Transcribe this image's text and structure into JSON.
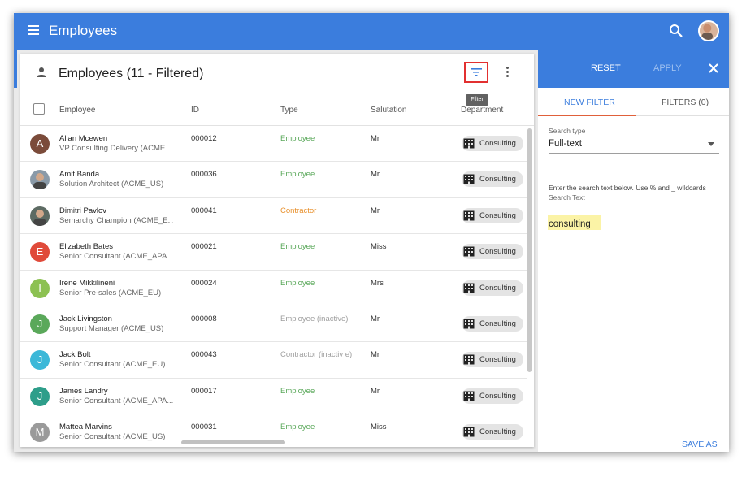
{
  "app": {
    "title": "Employees"
  },
  "list": {
    "title": "Employees (11 - Filtered)",
    "tooltip": "Filter",
    "columns": [
      "Employee",
      "ID",
      "Type",
      "Salutation",
      "Department"
    ],
    "rows": [
      {
        "initial": "A",
        "avatar_color": "#7b4b3a",
        "name": "Allan Mcewen",
        "subtitle": "VP Consulting Delivery (ACME...",
        "id": "000012",
        "type": "Employee",
        "type_color": "#5aa85a",
        "salutation": "Mr",
        "department": "Consulting"
      },
      {
        "initial": "",
        "avatar_color": "#8a9aa8",
        "name": "Amit Banda",
        "subtitle": "Solution Architect (ACME_US)",
        "id": "000036",
        "type": "Employee",
        "type_color": "#5aa85a",
        "salutation": "Mr",
        "department": "Consulting"
      },
      {
        "initial": "",
        "avatar_color": "#5d6b63",
        "name": "Dimitri Pavlov",
        "subtitle": "Semarchy Champion (ACME_E...",
        "id": "000041",
        "type": "Contractor",
        "type_color": "#e8902c",
        "salutation": "Mr",
        "department": "Consulting"
      },
      {
        "initial": "E",
        "avatar_color": "#e04a3a",
        "name": "Elizabeth Bates",
        "subtitle": "Senior Consultant (ACME_APA...",
        "id": "000021",
        "type": "Employee",
        "type_color": "#5aa85a",
        "salutation": "Miss",
        "department": "Consulting"
      },
      {
        "initial": "I",
        "avatar_color": "#8cc152",
        "name": "Irene Mikkilineni",
        "subtitle": "Senior Pre-sales (ACME_EU)",
        "id": "000024",
        "type": "Employee",
        "type_color": "#5aa85a",
        "salutation": "Mrs",
        "department": "Consulting"
      },
      {
        "initial": "J",
        "avatar_color": "#5aa85a",
        "name": "Jack Livingston",
        "subtitle": "Support Manager (ACME_US)",
        "id": "000008",
        "type": "Employee (inactive)",
        "type_color": "#9e9e9e",
        "salutation": "Mr",
        "department": "Consulting"
      },
      {
        "initial": "J",
        "avatar_color": "#3cb8d8",
        "name": "Jack Bolt",
        "subtitle": "Senior Consultant (ACME_EU)",
        "id": "000043",
        "type": "Contractor (inactiv e)",
        "type_color": "#9e9e9e",
        "salutation": "Mr",
        "department": "Consulting"
      },
      {
        "initial": "J",
        "avatar_color": "#2e9e8a",
        "name": "James Landry",
        "subtitle": "Senior Consultant (ACME_APA...",
        "id": "000017",
        "type": "Employee",
        "type_color": "#5aa85a",
        "salutation": "Mr",
        "department": "Consulting"
      },
      {
        "initial": "M",
        "avatar_color": "#9a9a9a",
        "name": "Mattea Marvins",
        "subtitle": "Senior Consultant (ACME_US)",
        "id": "000031",
        "type": "Employee",
        "type_color": "#5aa85a",
        "salutation": "Miss",
        "department": "Consulting"
      }
    ]
  },
  "panel": {
    "reset_label": "RESET",
    "apply_label": "APPLY",
    "tab_new": "NEW FILTER",
    "tab_filters": "FILTERS (0)",
    "search_type_label": "Search type",
    "search_type_value": "Full-text",
    "help_text": "Enter the search text below. Use % and _ wildcards",
    "search_text_label": "Search Text",
    "search_text_value": "consulting",
    "save_as_label": "SAVE AS"
  },
  "colors": {
    "primary": "#3b7ddd",
    "highlight_border": "#e23030",
    "tab_underline": "#e0603a"
  }
}
